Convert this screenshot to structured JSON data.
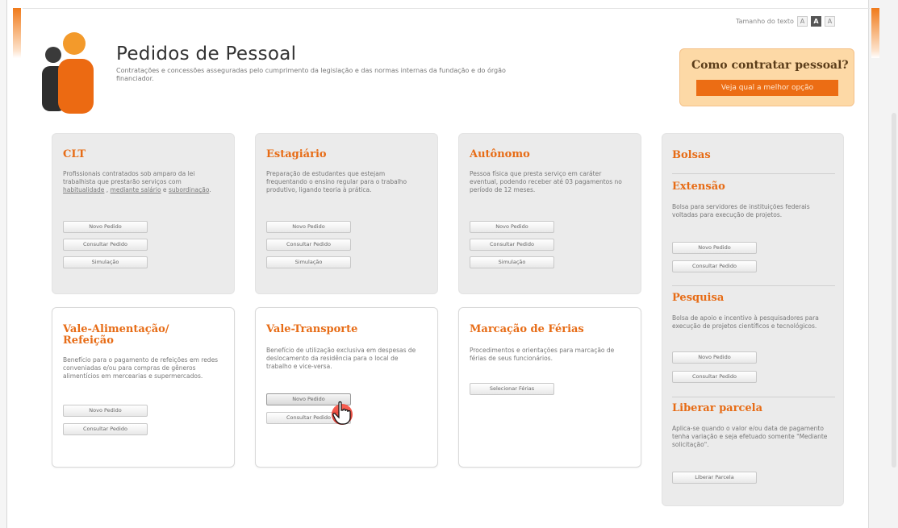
{
  "header": {
    "text_size_label": "Tamanho do texto",
    "text_size_options": [
      "A",
      "A",
      "A"
    ],
    "title": "Pedidos de Pessoal",
    "subtitle": "Contratações e concessões asseguradas pelo cumprimento da legislação e das normas internas da fundação e do órgão financiador."
  },
  "promo": {
    "title": "Como contratar pessoal?",
    "button": "Veja qual a melhor opção"
  },
  "cards": {
    "clt": {
      "title": "CLT",
      "desc_before": "Profissionais contratados sob amparo da lei trabalhista que prestarão serviços com ",
      "link1": "habitualidade",
      "sep": " , ",
      "link2": "mediante salário",
      "mid": " e ",
      "link3": "subordinação",
      "desc_after": ".",
      "buttons": [
        "Novo Pedido",
        "Consultar Pedido",
        "Simulação"
      ]
    },
    "estagiario": {
      "title": "Estagiário",
      "desc": "Preparação de estudantes que estejam frequentando o ensino regular para o trabalho produtivo, ligando teoria à prática.",
      "buttons": [
        "Novo Pedido",
        "Consultar Pedido",
        "Simulação"
      ]
    },
    "autonomo": {
      "title": "Autônomo",
      "desc": "Pessoa física que presta serviço em caráter eventual, podendo receber até 03 pagamentos no período de 12 meses.",
      "buttons": [
        "Novo Pedido",
        "Consultar Pedido",
        "Simulação"
      ]
    },
    "vale_alimentacao": {
      "title_line1": "Vale-Alimentação/",
      "title_line2": "Refeição",
      "desc": "Benefício para o pagamento de refeições em redes conveniadas e/ou para compras de gêneros alimentícios em mercearias e supermercados.",
      "buttons": [
        "Novo Pedido",
        "Consultar Pedido"
      ]
    },
    "vale_transporte": {
      "title": "Vale-Transporte",
      "desc": "Benefício de utilização exclusiva em despesas de deslocamento da residência para o local de trabalho e vice-versa.",
      "buttons": [
        "Novo Pedido",
        "Consultar Pedido"
      ]
    },
    "ferias": {
      "title": "Marcação de Férias",
      "desc": "Procedimentos e orientações para marcação de férias de seus funcionários.",
      "buttons": [
        "Selecionar Férias"
      ]
    }
  },
  "side": {
    "bolsas_title": "Bolsas",
    "extensao": {
      "title": "Extensão",
      "desc": "Bolsa para servidores de instituições federais voltadas para execução de projetos.",
      "buttons": [
        "Novo Pedido",
        "Consultar Pedido"
      ]
    },
    "pesquisa": {
      "title": "Pesquisa",
      "desc": "Bolsa de apoio e incentivo à pesquisadores para execução de projetos científicos e tecnológicos.",
      "buttons": [
        "Novo Pedido",
        "Consultar Pedido"
      ]
    },
    "liberar": {
      "title": "Liberar parcela",
      "desc": "Aplica-se quando o valor e/ou data de pagamento tenha variação e seja efetuado somente \"Mediante solicitação\".",
      "buttons": [
        "Liberar Parcela"
      ]
    }
  },
  "colors": {
    "accent": "#e76c16",
    "promo_bg": "#fdd9a6",
    "card_gray": "#ebebeb"
  }
}
